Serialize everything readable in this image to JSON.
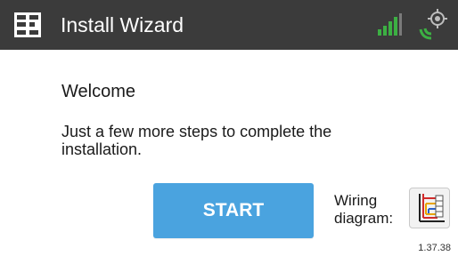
{
  "header": {
    "title": "Install Wizard",
    "logo_icon": "logo-icon",
    "signal_icon": "signal-strength-icon",
    "locate_icon": "gps-locate-icon",
    "colors": {
      "bar": "#3b3b3b",
      "signal": "#3cb043"
    }
  },
  "main": {
    "welcome": "Welcome",
    "message": "Just a few more steps to complete the installation.",
    "start_label": "START",
    "wiring_label": "Wiring diagram:",
    "wiring_icon": "wiring-diagram-icon",
    "version": "1.37.38",
    "colors": {
      "start_button": "#4aa3df"
    }
  }
}
